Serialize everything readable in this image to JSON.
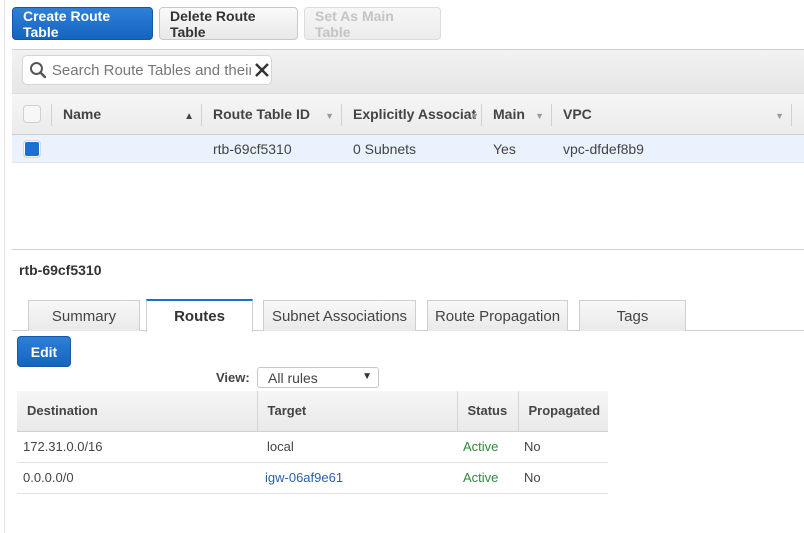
{
  "toolbar": {
    "create_label": "Create Route Table",
    "delete_label": "Delete Route Table",
    "set_main_label": "Set As Main Table"
  },
  "search": {
    "placeholder": "Search Route Tables and their proper"
  },
  "grid": {
    "columns": [
      {
        "label": "Name",
        "sort": "asc"
      },
      {
        "label": "Route Table ID",
        "sort": "none"
      },
      {
        "label": "Explicitly Associat",
        "sort": "none"
      },
      {
        "label": "Main",
        "sort": "none"
      },
      {
        "label": "VPC",
        "sort": "none"
      }
    ],
    "rows": [
      {
        "selected": true,
        "name": "",
        "route_table_id": "rtb-69cf5310",
        "explicitly_associated": "0 Subnets",
        "main": "Yes",
        "vpc": "vpc-dfdef8b9"
      }
    ]
  },
  "detail": {
    "title": "rtb-69cf5310",
    "tabs": [
      {
        "label": "Summary",
        "active": false
      },
      {
        "label": "Routes",
        "active": true
      },
      {
        "label": "Subnet Associations",
        "active": false
      },
      {
        "label": "Route Propagation",
        "active": false
      },
      {
        "label": "Tags",
        "active": false
      }
    ],
    "edit_label": "Edit",
    "view_label": "View:",
    "view_selected": "All rules",
    "routes": {
      "columns": [
        "Destination",
        "Target",
        "Status",
        "Propagated"
      ],
      "rows": [
        {
          "destination": "172.31.0.0/16",
          "target": "local",
          "target_link": false,
          "status": "Active",
          "propagated": "No"
        },
        {
          "destination": "0.0.0.0/0",
          "target": "igw-06af9e61",
          "target_link": true,
          "status": "Active",
          "propagated": "No"
        }
      ]
    }
  },
  "colors": {
    "primary": "#1a6fd1",
    "status_active": "#2e8b3a",
    "link": "#2a5db0",
    "selected_row": "#eaf2fd"
  }
}
